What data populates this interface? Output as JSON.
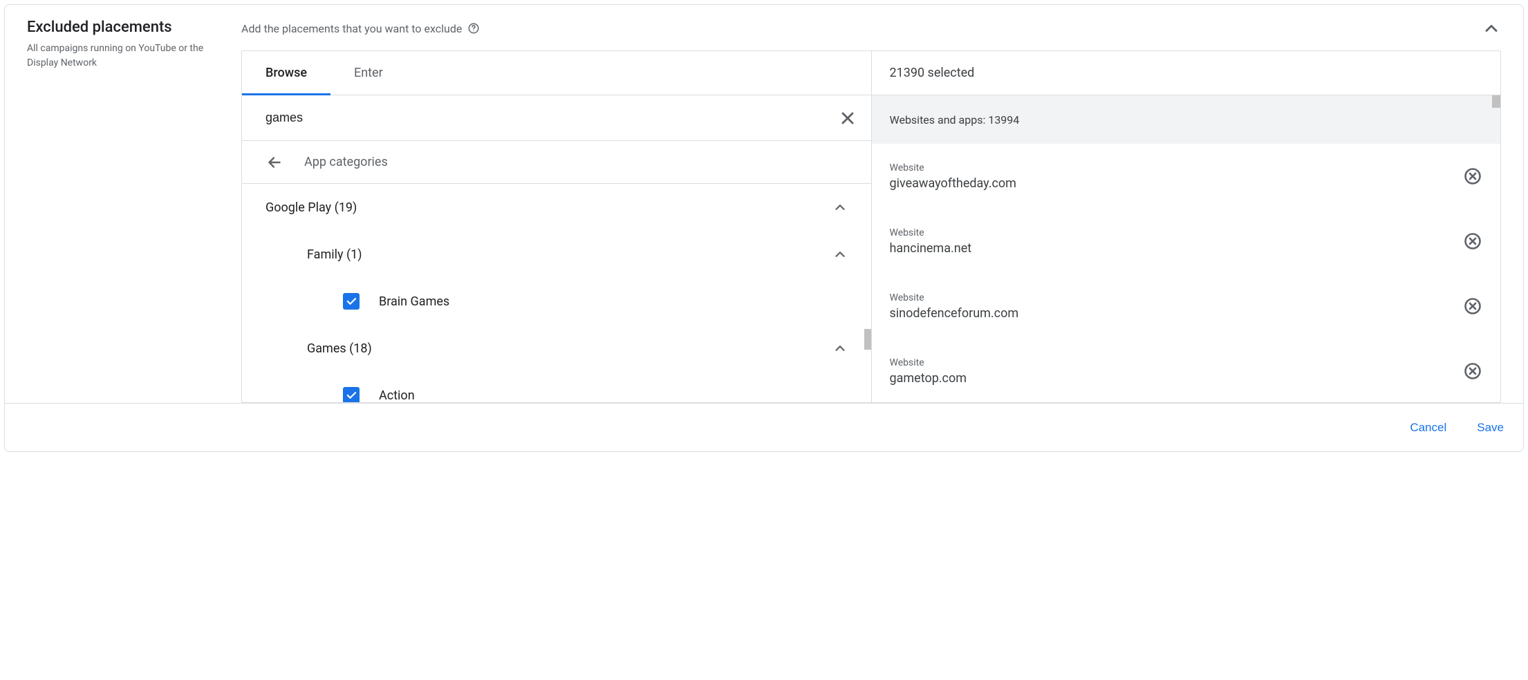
{
  "header": {
    "title": "Excluded placements",
    "subtitle": "All campaigns running on YouTube or the Display Network",
    "instruction": "Add the placements that you want to exclude"
  },
  "tabs": {
    "browse": "Browse",
    "enter": "Enter"
  },
  "search": {
    "value": "games"
  },
  "breadcrumb": {
    "label": "App categories"
  },
  "tree": {
    "google_play": "Google Play (19)",
    "family": "Family (1)",
    "brain_games": "Brain Games",
    "games": "Games (18)",
    "action": "Action"
  },
  "selected": {
    "count_label": "21390 selected",
    "group_header": "Websites and apps: 13994",
    "items": [
      {
        "type": "Website",
        "name": "giveawayoftheday.com"
      },
      {
        "type": "Website",
        "name": "hancinema.net"
      },
      {
        "type": "Website",
        "name": "sinodefenceforum.com"
      },
      {
        "type": "Website",
        "name": "gametop.com"
      }
    ]
  },
  "footer": {
    "cancel": "Cancel",
    "save": "Save"
  }
}
